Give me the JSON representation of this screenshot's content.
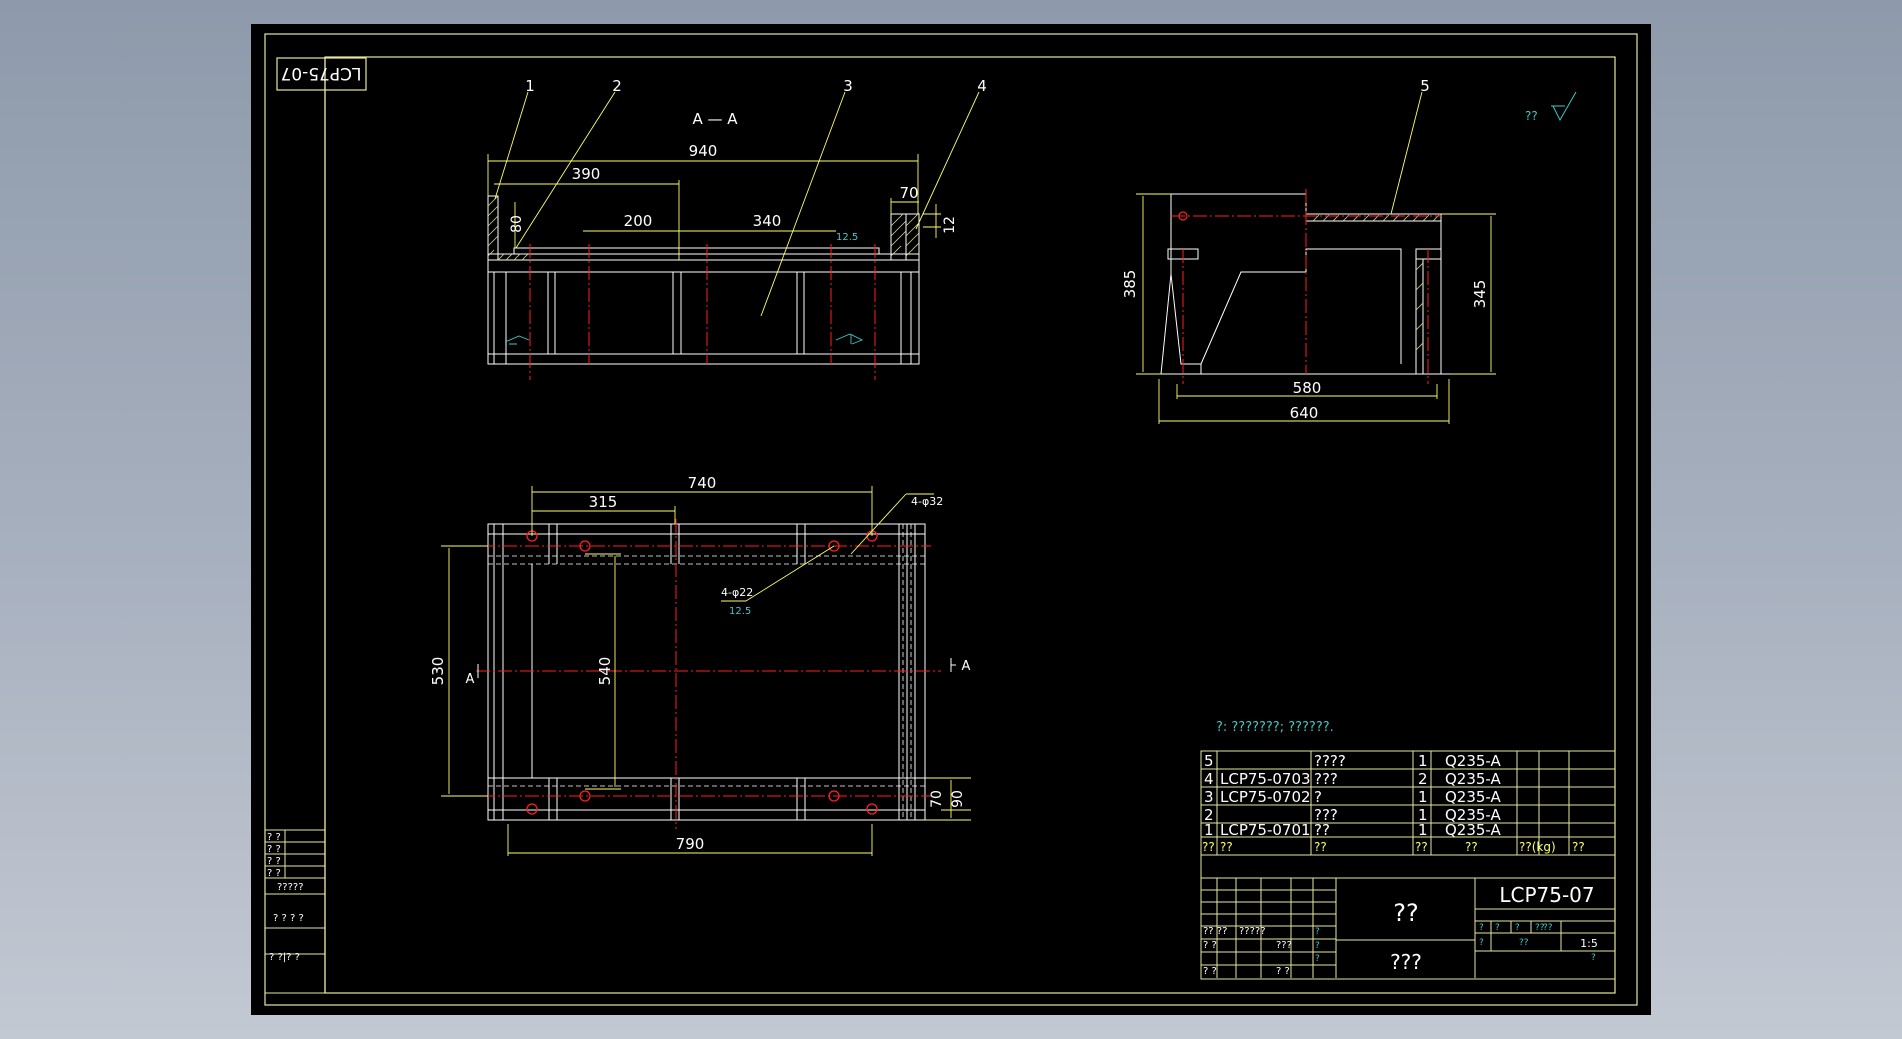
{
  "colors": {
    "sheet": "#000000",
    "frame": "#e8e6a0",
    "line": "#ffffff",
    "dim": "#ffff66",
    "center": "#ff2020",
    "note": "#40c8c8",
    "hatch": "#d8d890"
  },
  "title_box": {
    "code_rotated": "LCP75-07"
  },
  "section_view": {
    "title": "A — A",
    "balloons": [
      "1",
      "2",
      "3",
      "4"
    ],
    "dims": {
      "overall": "940",
      "left": "390",
      "mid1": "200",
      "mid2": "340",
      "right": "70",
      "height": "80",
      "plate": "12"
    },
    "roughness": "12.5"
  },
  "side_view": {
    "balloon": "5",
    "dims": {
      "height_left": "385",
      "height_right": "345",
      "inner": "580",
      "outer": "640"
    }
  },
  "top_view": {
    "dims": {
      "top": "740",
      "top_left": "315",
      "height": "530",
      "inner": "540",
      "bottom": "790",
      "rail1": "70",
      "rail2": "90"
    },
    "holes_large": "4-φ32",
    "holes_small": "4-φ22",
    "roughness": "12.5",
    "section_mark": "A"
  },
  "roughness_mark": {
    "label": "??"
  },
  "tech_note": "?: ???????; ??????.",
  "parts_table": {
    "rows": [
      {
        "no": "5",
        "code": "",
        "name": "????",
        "qty": "1",
        "material": "Q235-A"
      },
      {
        "no": "4",
        "code": "LCP75-0703",
        "name": "???",
        "qty": "2",
        "material": "Q235-A"
      },
      {
        "no": "3",
        "code": "LCP75-0702",
        "name": "?",
        "qty": "1",
        "material": "Q235-A"
      },
      {
        "no": "2",
        "code": "",
        "name": "???",
        "qty": "1",
        "material": "Q235-A"
      },
      {
        "no": "1",
        "code": "LCP75-0701",
        "name": "??",
        "qty": "1",
        "material": "Q235-A"
      }
    ],
    "header": {
      "no": "??",
      "code": "??",
      "name": "??",
      "qty": "??",
      "material": "??",
      "mass": "??(kg)",
      "remark": "??"
    }
  },
  "title_block": {
    "drawing_no": "LCP75-07",
    "name": "??",
    "company": "???",
    "scale": "1:5",
    "sign_labels": [
      "?? ??",
      "?????",
      "? ?",
      "???",
      "? ?",
      "? ?"
    ],
    "small_cells": [
      "?",
      "?",
      "?",
      "??",
      "?",
      "??",
      "??",
      "?"
    ],
    "mid_cells": [
      "?",
      "?",
      "?"
    ]
  },
  "side_table": {
    "cells": [
      "? ?",
      "? ?",
      "? ?",
      "? ?",
      "?????",
      "? ? ? ?",
      "? ?|? ?"
    ]
  }
}
